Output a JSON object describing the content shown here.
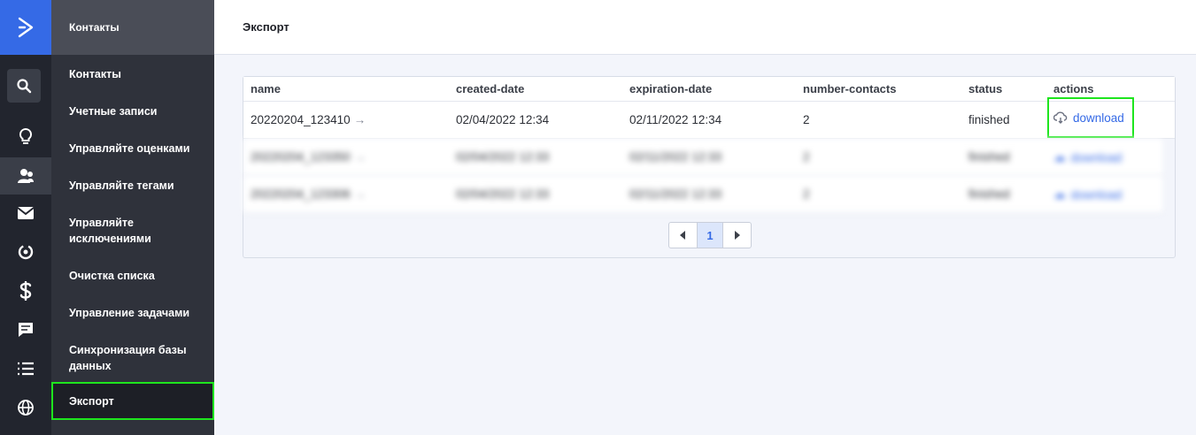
{
  "nav": {
    "section_title": "Контакты",
    "items": [
      {
        "label": "Контакты"
      },
      {
        "label": "Учетные записи"
      },
      {
        "label": "Управляйте оценками"
      },
      {
        "label": "Управляйте тегами"
      },
      {
        "label": "Управляйте исключениями"
      },
      {
        "label": "Очистка списка"
      },
      {
        "label": "Управление задачами"
      },
      {
        "label": "Синхронизация базы данных"
      },
      {
        "label": "Экспорт"
      }
    ]
  },
  "page": {
    "title": "Экспорт"
  },
  "table": {
    "columns": [
      "name",
      "created-date",
      "expiration-date",
      "number-contacts",
      "status",
      "actions"
    ],
    "rows": [
      {
        "name": "20220204_123410",
        "created": "02/04/2022 12:34",
        "expiration": "02/11/2022 12:34",
        "count": "2",
        "status": "finished",
        "action": "download"
      },
      {
        "name": "20220204_123350",
        "created": "02/04/2022 12:33",
        "expiration": "02/11/2022 12:33",
        "count": "2",
        "status": "finished",
        "action": "download"
      },
      {
        "name": "20220204_123306",
        "created": "02/04/2022 12:33",
        "expiration": "02/11/2022 12:33",
        "count": "2",
        "status": "finished",
        "action": "download"
      }
    ]
  },
  "pagination": {
    "current": "1"
  },
  "icons": [
    "logo-chevron-icon",
    "search-icon",
    "lightbulb-icon",
    "contacts-icon",
    "mail-icon",
    "automation-icon",
    "dollar-icon",
    "chat-icon",
    "list-icon",
    "globe-icon",
    "cloud-download-icon",
    "arrow-right-icon",
    "caret-left-icon",
    "caret-right-icon"
  ],
  "colors": {
    "accent": "#356ae6",
    "highlight": "#1ee51e",
    "rail": "#22252e",
    "nav": "#2f323b"
  }
}
